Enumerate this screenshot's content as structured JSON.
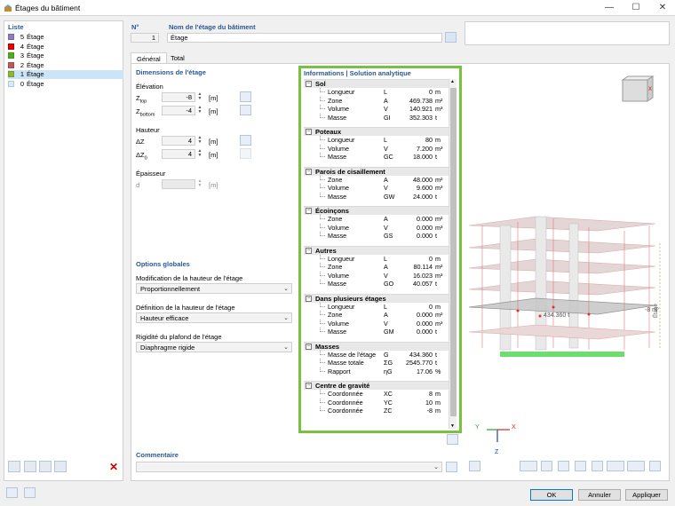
{
  "window": {
    "title": "Étages du bâtiment",
    "btn_min": "—",
    "btn_max": "☐",
    "btn_close": "✕"
  },
  "list": {
    "header": "Liste",
    "items": [
      {
        "num": "5",
        "label": "Étage",
        "color": "#8e7cc3",
        "selected": false
      },
      {
        "num": "4",
        "label": "Étage",
        "color": "#e00000",
        "selected": false
      },
      {
        "num": "3",
        "label": "Étage",
        "color": "#4caf20",
        "selected": false
      },
      {
        "num": "2",
        "label": "Étage",
        "color": "#b85c5c",
        "selected": false
      },
      {
        "num": "1",
        "label": "Étage",
        "color": "#8db63c",
        "selected": true
      },
      {
        "num": "0",
        "label": "Étage",
        "color": "#d8ecf8",
        "selected": false
      }
    ]
  },
  "header": {
    "no_label": "N°",
    "no_value": "1",
    "name_label": "Nom de l'étage du bâtiment",
    "name_value": "Étage"
  },
  "tabs": [
    "Général",
    "Total"
  ],
  "dimensions": {
    "title": "Dimensions de l'étage",
    "elevation_label": "Élévation",
    "ztop_label": "Z",
    "ztop_sub": "top",
    "ztop_value": "-8",
    "ztop_unit": "[m]",
    "zbottom_label": "Z",
    "zbottom_sub": "bottom",
    "zbottom_value": "-4",
    "zbottom_unit": "[m]",
    "height_label": "Hauteur",
    "dz_label": "ΔZ",
    "dz_value": "4",
    "dz_unit": "[m]",
    "dz0_label": "ΔZ",
    "dz0_sub": "0",
    "dz0_value": "4",
    "dz0_unit": "[m]",
    "thickness_label": "Épaisseur",
    "d_label": "d",
    "d_value": "",
    "d_unit": "[m]"
  },
  "global": {
    "title": "Options globales",
    "opt1_label": "Modification de la hauteur de l'étage",
    "opt1_value": "Proportionnellement",
    "opt2_label": "Définition de la hauteur de l'étage",
    "opt2_value": "Hauteur efficace",
    "opt3_label": "Rigidité du plafond de l'étage",
    "opt3_value": "Diaphragme rigide"
  },
  "info": {
    "title": "Informations | Solution analytique",
    "sections": [
      {
        "name": "Sol",
        "rows": [
          [
            "Longueur",
            "L",
            "0",
            "m"
          ],
          [
            "Zone",
            "A",
            "469.738",
            "m²"
          ],
          [
            "Volume",
            "V",
            "140.921",
            "m³"
          ],
          [
            "Masse",
            "GI",
            "352.303",
            "t"
          ]
        ]
      },
      {
        "name": "Poteaux",
        "rows": [
          [
            "Longueur",
            "L",
            "80",
            "m"
          ],
          [
            "Volume",
            "V",
            "7.200",
            "m³"
          ],
          [
            "Masse",
            "GC",
            "18.000",
            "t"
          ]
        ]
      },
      {
        "name": "Parois de cisaillement",
        "rows": [
          [
            "Zone",
            "A",
            "48.000",
            "m²"
          ],
          [
            "Volume",
            "V",
            "9.600",
            "m³"
          ],
          [
            "Masse",
            "GW",
            "24.000",
            "t"
          ]
        ]
      },
      {
        "name": "Écoinçons",
        "rows": [
          [
            "Zone",
            "A",
            "0.000",
            "m²"
          ],
          [
            "Volume",
            "V",
            "0.000",
            "m³"
          ],
          [
            "Masse",
            "GS",
            "0.000",
            "t"
          ]
        ]
      },
      {
        "name": "Autres",
        "rows": [
          [
            "Longueur",
            "L",
            "0",
            "m"
          ],
          [
            "Zone",
            "A",
            "80.114",
            "m²"
          ],
          [
            "Volume",
            "V",
            "16.023",
            "m³"
          ],
          [
            "Masse",
            "GO",
            "40.057",
            "t"
          ]
        ]
      },
      {
        "name": "Dans plusieurs étages",
        "rows": [
          [
            "Longueur",
            "L",
            "0",
            "m"
          ],
          [
            "Zone",
            "A",
            "0.000",
            "m²"
          ],
          [
            "Volume",
            "V",
            "0.000",
            "m³"
          ],
          [
            "Masse",
            "GM",
            "0.000",
            "t"
          ]
        ]
      },
      {
        "name": "Masses",
        "rows": [
          [
            "Masse de l'étage",
            "G",
            "434.360",
            "t"
          ],
          [
            "Masse totale",
            "ΣG",
            "2545.770",
            "t"
          ],
          [
            "Rapport",
            "ηG",
            "17.06",
            "%"
          ]
        ]
      },
      {
        "name": "Centre de gravité",
        "rows": [
          [
            "Coordonnée",
            "XC",
            "8",
            "m"
          ],
          [
            "Coordonnée",
            "YC",
            "10",
            "m"
          ],
          [
            "Coordonnée",
            "ZC",
            "-8",
            "m"
          ]
        ]
      }
    ]
  },
  "comment": {
    "title": "Commentaire",
    "value": ""
  },
  "view": {
    "mass_label": "434.360 t",
    "z_label": "-8 m",
    "floor_label": "Étage",
    "axis_x": "X",
    "axis_y": "Y",
    "axis_z": "Z",
    "cube_x": "X"
  },
  "buttons": {
    "ok": "OK",
    "cancel": "Annuler",
    "apply": "Appliquer"
  },
  "colors": {
    "accent": "#7ac142",
    "header_blue": "#2b5797",
    "selection": "#cce4f7"
  }
}
